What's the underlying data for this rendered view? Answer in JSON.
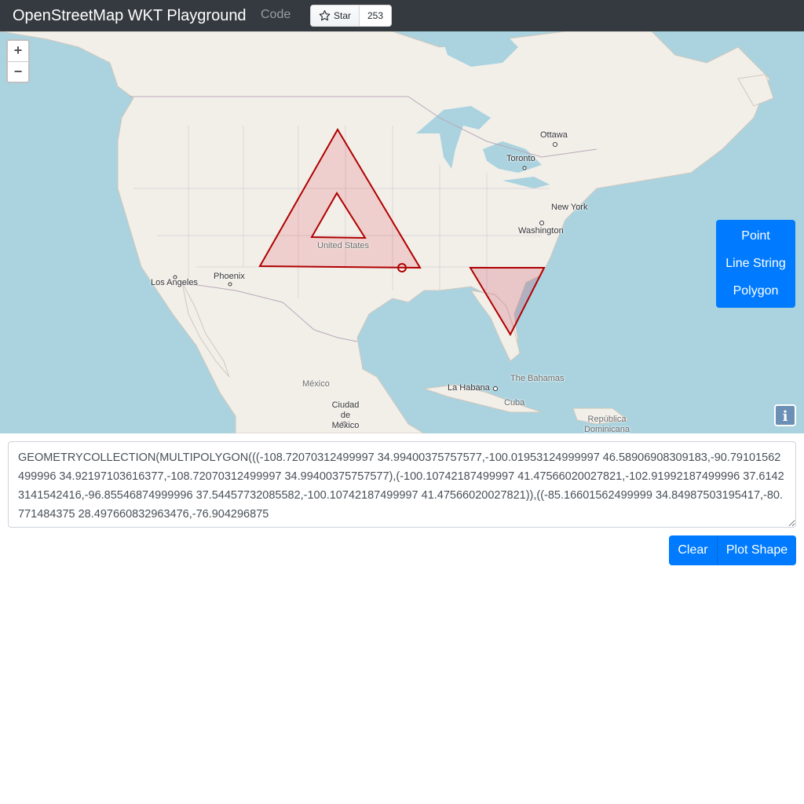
{
  "navbar": {
    "brand": "OpenStreetMap WKT Playground",
    "code_link": "Code",
    "github_star_label": "Star",
    "github_star_count": "253"
  },
  "map": {
    "zoom_in": "+",
    "zoom_out": "−",
    "info_button": "i",
    "labels": {
      "ottawa": "Ottawa",
      "toronto": "Toronto",
      "new_york": "New York",
      "washington": "Washington",
      "united_states": "United States",
      "phoenix": "Phoenix",
      "los_angeles": "Los Angeles",
      "mexico": "México",
      "ciudad_de_mexico": "Ciudad de México",
      "la_habana": "La Habana",
      "the_bahamas": "The Bahamas",
      "cuba": "Cuba",
      "republica_dominicana": "República Dominicana"
    },
    "colors": {
      "water": "#aad3df",
      "land": "#f2efe9",
      "shape_stroke": "#b00000",
      "shape_fill": "rgba(220,60,80,0.18)"
    }
  },
  "shape_panel": {
    "point": "Point",
    "line_string": "Line String",
    "polygon": "Polygon"
  },
  "wkt_input": {
    "value": "GEOMETRYCOLLECTION(MULTIPOLYGON(((-108.72070312499997 34.99400375757577,-100.01953124999997 46.58906908309183,-90.79101562499996 34.92197103616377,-108.72070312499997 34.99400375757577),(-100.10742187499997 41.47566020027821,-102.91992187499996 37.61423141542416,-96.85546874999996 37.54457732085582,-100.10742187499997 41.47566020027821)),((-85.16601562499999 34.84987503195417,-80.771484375 28.497660832963476,-76.904296875"
  },
  "actions": {
    "clear": "Clear",
    "plot_shape": "Plot Shape"
  }
}
